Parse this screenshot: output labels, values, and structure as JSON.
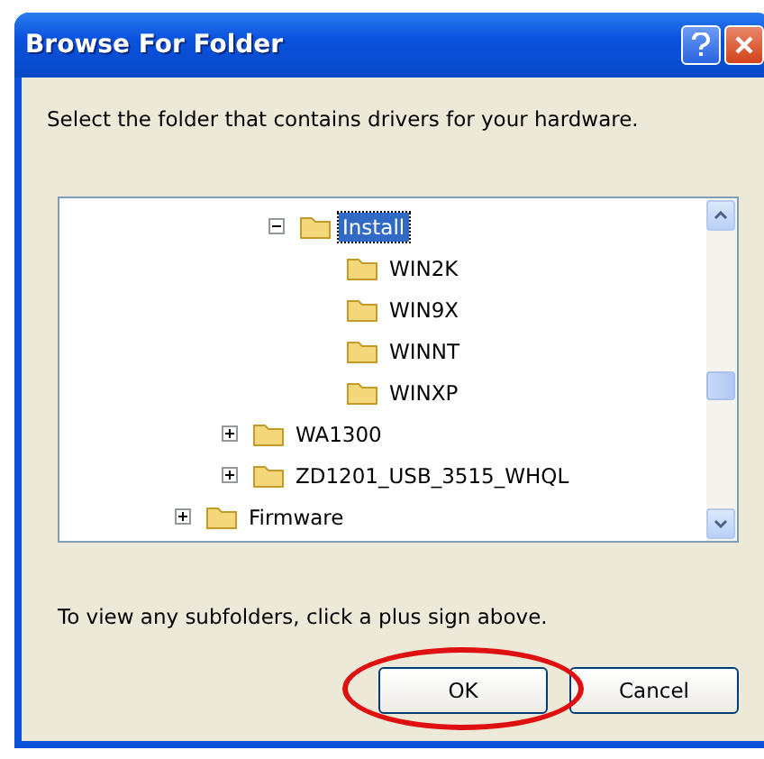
{
  "window": {
    "title": "Browse For Folder"
  },
  "instruction": "Select the folder that contains drivers for your hardware.",
  "tree": {
    "items": [
      {
        "children": [
          {
            "children": [
              {
                "label": "Install",
                "expanded": true,
                "selected": true,
                "children": [
                  {
                    "label": "WIN2K",
                    "selected": false
                  },
                  {
                    "label": "WIN9X",
                    "selected": false
                  },
                  {
                    "label": "WINNT",
                    "selected": false
                  },
                  {
                    "label": "WINXP",
                    "selected": false
                  }
                ]
              }
            ]
          },
          {
            "label": "WA1300",
            "expanded": false,
            "selected": false
          },
          {
            "label": "ZD1201_USB_3515_WHQL",
            "expanded": false,
            "selected": false
          }
        ]
      },
      {
        "label": "Firmware",
        "expanded": false,
        "selected": false
      }
    ]
  },
  "hint": "To view any subfolders, click a plus sign above.",
  "buttons": [
    {
      "label": "OK",
      "circled": true
    },
    {
      "label": "Cancel",
      "circled": false
    }
  ]
}
